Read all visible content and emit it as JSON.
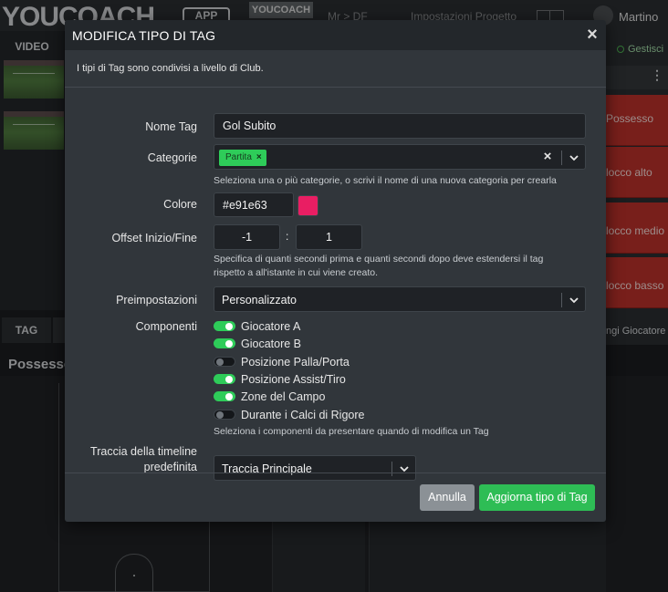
{
  "background": {
    "logo_text": "YOUCOACH",
    "logo_suffix": "APP",
    "chip_logo": "YOUCOACH",
    "top_links": [
      "Mr > DF",
      "Impostazioni Progetto"
    ],
    "user_name": "Martino",
    "video_tab": "VIDEO",
    "tag_tab": "TAG",
    "possesso_title": "Possesso",
    "gestisci": "Gestisci",
    "right_tags": [
      "Possesso",
      "locco alto",
      "locco medio",
      "locco basso"
    ],
    "right_footer": "ngi Giocatore"
  },
  "modal": {
    "title": "MODIFICA TIPO DI TAG",
    "close_label": "×",
    "info": "I tipi di Tag sono condivisi a livello di Club.",
    "fields": {
      "nome_tag": {
        "label": "Nome Tag",
        "value": "Gol Subito"
      },
      "categorie": {
        "label": "Categorie",
        "chip": "Partita",
        "chip_remove": "×",
        "clear": "×",
        "help": "Seleziona una o più categorie, o scrivi il nome di una nuova categoria per crearla"
      },
      "colore": {
        "label": "Colore",
        "value": "#e91e63",
        "swatch_color": "#e91e63"
      },
      "offset": {
        "label": "Offset Inizio/Fine",
        "start": "-1",
        "separator": ":",
        "end": "1",
        "help_line1": "Specifica di quanti secondi prima e quanti secondi dopo deve estendersi il tag",
        "help_line2": "rispetto a all'istante in cui viene creato."
      },
      "preimpostazioni": {
        "label": "Preimpostazioni",
        "value": "Personalizzato"
      },
      "componenti": {
        "label": "Componenti",
        "items": [
          {
            "label": "Giocatore A",
            "on": true
          },
          {
            "label": "Giocatore B",
            "on": true
          },
          {
            "label": "Posizione Palla/Porta",
            "on": false
          },
          {
            "label": "Posizione Assist/Tiro",
            "on": true
          },
          {
            "label": "Zone del Campo",
            "on": true
          },
          {
            "label": "Durante i Calci di Rigore",
            "on": false
          }
        ],
        "help": "Seleziona i componenti da presentare quando di modifica un Tag"
      },
      "traccia": {
        "label_line1": "Traccia della timeline",
        "label_line2": "predefinita",
        "value": "Traccia Principale"
      }
    },
    "buttons": {
      "cancel": "Annulla",
      "submit": "Aggiorna tipo di Tag"
    }
  },
  "colors": {
    "accent_green": "#2ecc59",
    "modal_bg": "#31363b",
    "header_bg": "#23272b",
    "input_bg": "#1f2226",
    "tag_red": "#b8302a"
  }
}
